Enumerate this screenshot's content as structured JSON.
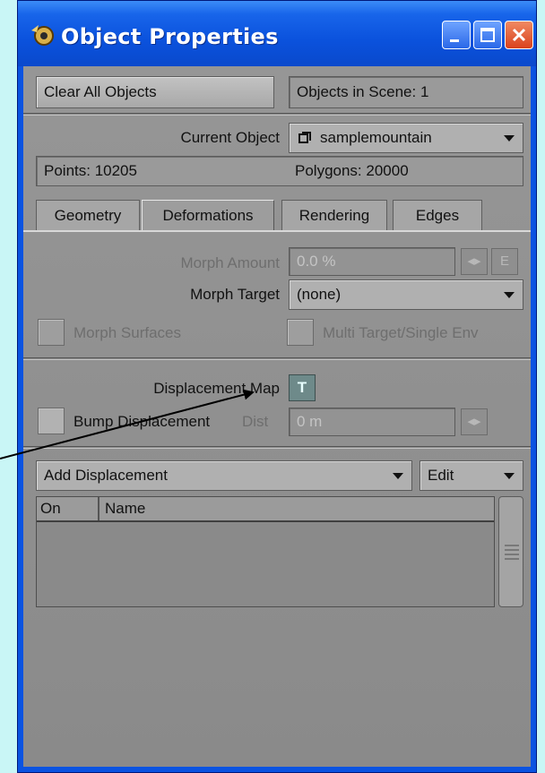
{
  "window": {
    "title": "Object Properties",
    "controls": {
      "minimize": "minimize-icon",
      "maximize": "maximize-icon",
      "close": "close-icon"
    }
  },
  "header": {
    "clear_all_objects": "Clear All Objects",
    "objects_in_scene": "Objects in Scene: 1"
  },
  "object": {
    "current_object_label": "Current Object",
    "current_object_value": "samplemountain",
    "points": "Points: 10205",
    "polygons": "Polygons: 20000"
  },
  "tabs": [
    {
      "label": "Geometry",
      "active": false
    },
    {
      "label": "Deformations",
      "active": true
    },
    {
      "label": "Rendering",
      "active": false
    },
    {
      "label": "Edges",
      "active": false
    }
  ],
  "deformations": {
    "morph_amount_label": "Morph Amount",
    "morph_amount_value": "0.0 %",
    "envelope_button": "E",
    "morph_target_label": "Morph Target",
    "morph_target_value": "(none)",
    "morph_surfaces_label": "Morph Surfaces",
    "multi_target_label": "Multi Target/Single Env",
    "displacement_map_label": "Displacement Map",
    "texture_button": "T",
    "bump_displacement_label": "Bump Displacement",
    "dist_label": "Dist",
    "dist_value": "0 m"
  },
  "plugins": {
    "add_displacement": "Add Displacement",
    "edit": "Edit",
    "columns": [
      "On",
      "Name"
    ]
  },
  "colors": {
    "titlebar": "#0a53e1",
    "panel": "#8d8d8d",
    "background": "#c9f6f6"
  }
}
